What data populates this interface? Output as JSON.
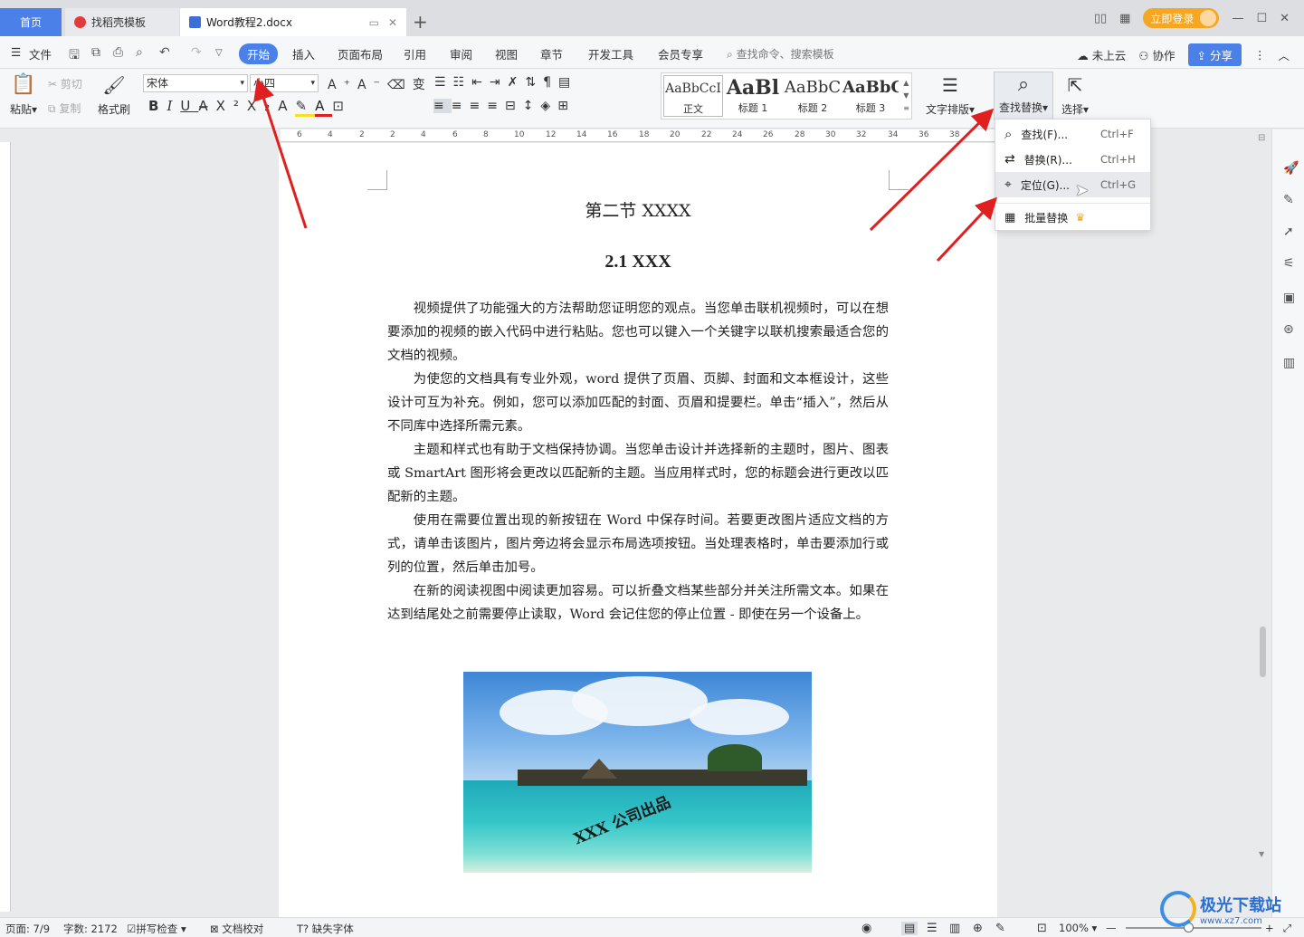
{
  "tabs": {
    "home": "首页",
    "template": "找稻壳模板",
    "document": "Word教程2.docx",
    "login": "立即登录"
  },
  "menu": {
    "file": "文件",
    "items": [
      "开始",
      "插入",
      "页面布局",
      "引用",
      "审阅",
      "视图",
      "章节",
      "开发工具",
      "会员专享"
    ],
    "search_placeholder": "查找命令、搜索模板",
    "cloud": "未上云",
    "collab": "协作",
    "share": "分享"
  },
  "ribbon": {
    "paste": "粘贴",
    "cut": "剪切",
    "copy": "复制",
    "format_painter": "格式刷",
    "font_name": "宋体",
    "font_size": "小四",
    "styles": [
      {
        "preview": "AaBbCcI",
        "label": "正文"
      },
      {
        "preview": "AaBl",
        "label": "标题 1"
      },
      {
        "preview": "AaBbC",
        "label": "标题 2"
      },
      {
        "preview": "AaBbC",
        "label": "标题 3"
      }
    ],
    "text_layout": "文字排版",
    "find_replace": "查找替换",
    "select": "选择"
  },
  "ruler_numbers": [
    "6",
    "4",
    "2",
    "2",
    "4",
    "6",
    "8",
    "10",
    "12",
    "14",
    "16",
    "18",
    "20",
    "22",
    "24",
    "26",
    "28",
    "30",
    "32",
    "34",
    "36",
    "38"
  ],
  "dropdown": [
    {
      "label": "查找(F)...",
      "shortcut": "Ctrl+F"
    },
    {
      "label": "替换(R)...",
      "shortcut": "Ctrl+H"
    },
    {
      "label": "定位(G)...",
      "shortcut": "Ctrl+G"
    },
    {
      "label": "批量替换",
      "shortcut": ""
    }
  ],
  "document": {
    "heading1": "第二节  XXXX",
    "heading2": "2.1 XXX",
    "paragraphs": [
      "视频提供了功能强大的方法帮助您证明您的观点。当您单击联机视频时，可以在想要添加的视频的嵌入代码中进行粘贴。您也可以键入一个关键字以联机搜索最适合您的文档的视频。",
      "为使您的文档具有专业外观，word 提供了页眉、页脚、封面和文本框设计，这些设计可互为补充。例如，您可以添加匹配的封面、页眉和提要栏。单击“插入”，然后从不同库中选择所需元素。",
      "主题和样式也有助于文档保持协调。当您单击设计并选择新的主题时，图片、图表或 SmartArt 图形将会更改以匹配新的主题。当应用样式时，您的标题会进行更改以匹配新的主题。",
      "使用在需要位置出现的新按钮在 Word 中保存时间。若要更改图片适应文档的方式，请单击该图片，图片旁边将会显示布局选项按钮。当处理表格时，单击要添加行或列的位置，然后单击加号。",
      "在新的阅读视图中阅读更加容易。可以折叠文档某些部分并关注所需文本。如果在达到结尾处之前需要停止读取，Word 会记住您的停止位置 - 即使在另一个设备上。"
    ],
    "image_watermark": "XXX 公司出品"
  },
  "status": {
    "page": "页面: 7/9",
    "words": "字数: 2172",
    "spell": "拼写检查",
    "proof": "文档校对",
    "missing_font": "缺失字体",
    "zoom": "100%"
  },
  "watermark_site": "极光下载站",
  "watermark_url": "www.xz7.com"
}
